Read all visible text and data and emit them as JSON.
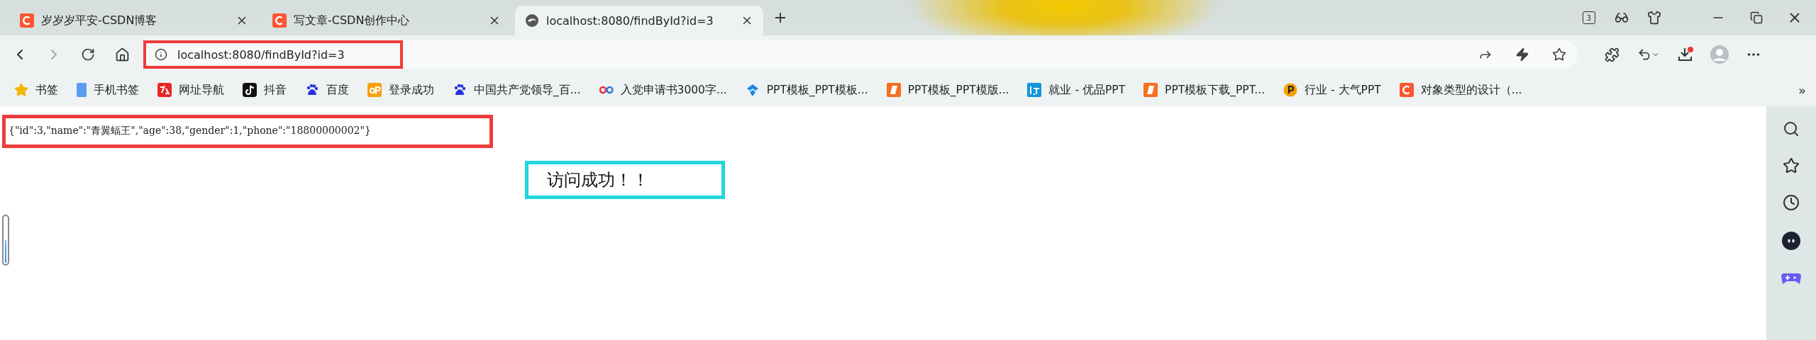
{
  "tabs": [
    {
      "title": "岁岁岁平安-CSDN博客",
      "kind": "csdn",
      "selected": false
    },
    {
      "title": "写文章-CSDN创作中心",
      "kind": "csdn",
      "selected": false
    },
    {
      "title": "localhost:8080/findById?id=3",
      "kind": "edge",
      "selected": true
    }
  ],
  "tab_count": "3",
  "address_bar": {
    "url": "localhost:8080/findById?id=3"
  },
  "bookmarks": [
    {
      "label": "书签",
      "kind": "star"
    },
    {
      "label": "手机书签",
      "kind": "phone"
    },
    {
      "label": "网址导航",
      "kind": "nav"
    },
    {
      "label": "抖音",
      "kind": "note"
    },
    {
      "label": "百度",
      "kind": "paw"
    },
    {
      "label": "登录成功",
      "kind": "ep"
    },
    {
      "label": "中国共产党领导_百...",
      "kind": "paw"
    },
    {
      "label": "入党申请书3000字...",
      "kind": "eightg"
    },
    {
      "label": "PPT模板_PPT模板...",
      "kind": "bluewing"
    },
    {
      "label": "PPT模板_PPT模版...",
      "kind": "orangeslab"
    },
    {
      "label": "就业 - 优品PPT",
      "kind": "bluesquare"
    },
    {
      "label": "PPT模板下载_PPT...",
      "kind": "orangeslab"
    },
    {
      "label": "行业 - 大气PPT",
      "kind": "orangecoin"
    },
    {
      "label": "对象类型的设计（...",
      "kind": "csdn"
    }
  ],
  "more_bookmarks": "»",
  "page": {
    "json_text": "{\"id\":3,\"name\":\"青翼蝠王\",\"age\":38,\"gender\":1,\"phone\":\"18800000002\"}",
    "message": "访问成功！！",
    "indicator": {
      "level": 0.5
    }
  }
}
